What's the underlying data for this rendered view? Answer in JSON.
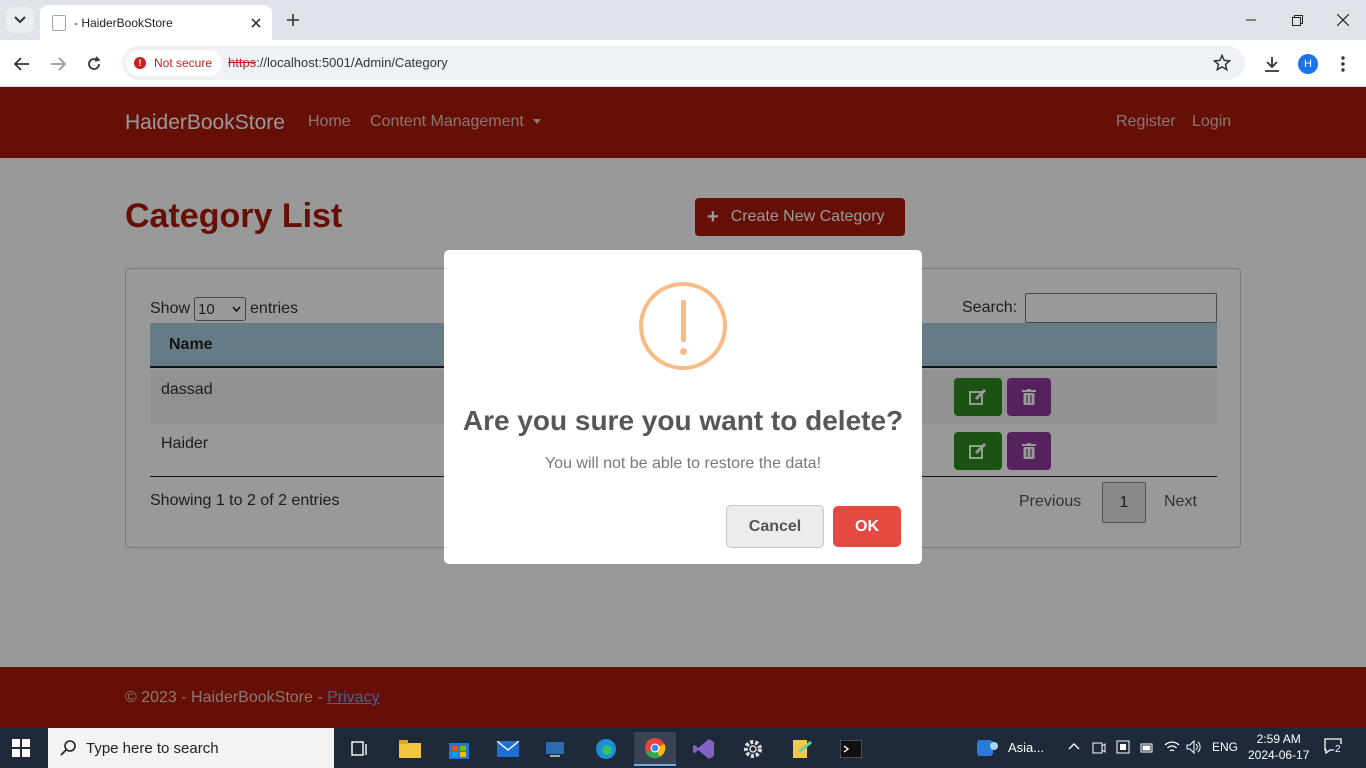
{
  "browser": {
    "tab_title": "- HaiderBookStore",
    "security_label": "Not secure",
    "url_scheme": "https",
    "url_rest": "://localhost:5001/Admin/Category",
    "profile_initial": "H"
  },
  "navbar": {
    "brand": "HaiderBookStore",
    "home": "Home",
    "content_management": "Content Management",
    "register": "Register",
    "login": "Login"
  },
  "main": {
    "title": "Category List",
    "create_button": "Create New Category",
    "show_label": "Show",
    "entries_value": "10",
    "entries_label": "entries",
    "search_label": "Search:",
    "search_value": "",
    "column_name": "Name",
    "rows": [
      {
        "name": "dassad"
      },
      {
        "name": "Haider"
      }
    ],
    "info": "Showing 1 to 2 of 2 entries",
    "pagination": {
      "previous": "Previous",
      "current": "1",
      "next": "Next"
    }
  },
  "footer": {
    "text": "© 2023 - HaiderBookStore - ",
    "privacy_link": "Privacy"
  },
  "modal": {
    "title": "Are you sure you want to delete?",
    "text": "You will not be able to restore the data!",
    "cancel": "Cancel",
    "ok": "OK",
    "icon_color": "#f8bb86",
    "ok_color": "#e64942"
  },
  "taskbar": {
    "search_placeholder": "Type here to search",
    "weather": "Asia...",
    "language": "ENG",
    "time": "2:59 AM",
    "date": "2024-06-17",
    "notifications": "2"
  },
  "colors": {
    "brand": "#a8190b",
    "edit": "#2d8a1f",
    "delete": "#8e3a9c",
    "table_header": "#a9cfe0"
  }
}
